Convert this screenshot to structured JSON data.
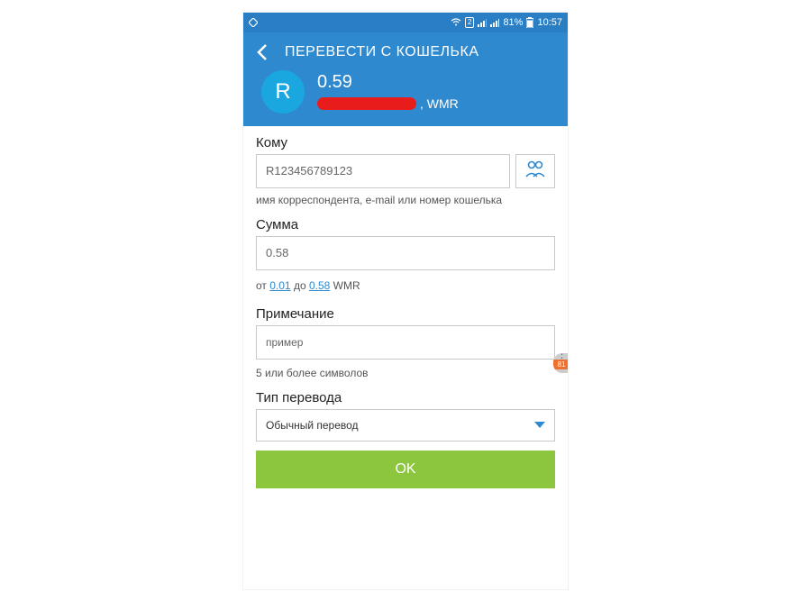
{
  "status": {
    "battery_text": "81%",
    "time": "10:57",
    "sim_badge": "2"
  },
  "header": {
    "title": "ПЕРЕВЕСТИ С КОШЕЛЬКА",
    "wallet_letter": "R",
    "balance": "0.59",
    "wallet_suffix": ", WMR"
  },
  "form": {
    "to_label": "Кому",
    "to_value": "R123456789123",
    "to_hint": "имя корреспондента, e-mail или номер кошелька",
    "amount_label": "Сумма",
    "amount_value": "0.58",
    "range_prefix": "от ",
    "range_min": "0.01",
    "range_mid": " до ",
    "range_max": "0.58",
    "range_suffix": " WMR",
    "note_label": "Примечание",
    "note_value": "пример",
    "note_hint": "5 или более символов",
    "type_label": "Тип перевода",
    "type_value": "Обычный перевод",
    "ok": "OK"
  },
  "edge": {
    "count": "81"
  }
}
